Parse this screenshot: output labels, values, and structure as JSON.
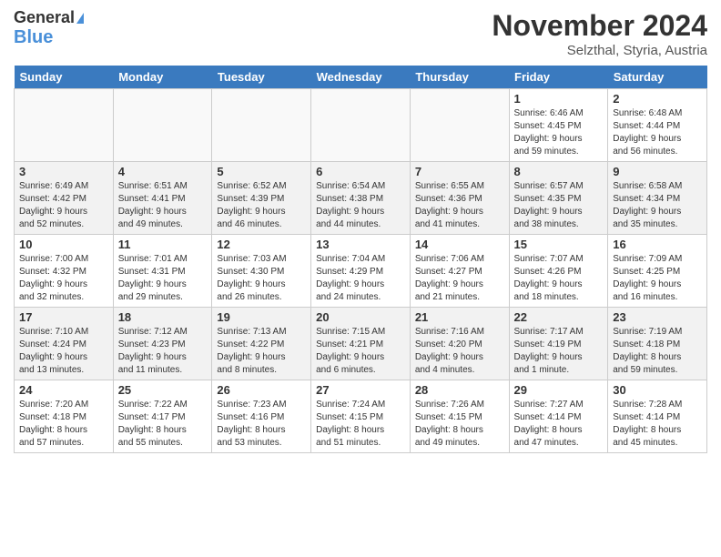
{
  "header": {
    "logo_line1": "General",
    "logo_line2": "Blue",
    "month_title": "November 2024",
    "location": "Selzthal, Styria, Austria"
  },
  "days_of_week": [
    "Sunday",
    "Monday",
    "Tuesday",
    "Wednesday",
    "Thursday",
    "Friday",
    "Saturday"
  ],
  "weeks": [
    [
      {
        "day": "",
        "info": ""
      },
      {
        "day": "",
        "info": ""
      },
      {
        "day": "",
        "info": ""
      },
      {
        "day": "",
        "info": ""
      },
      {
        "day": "",
        "info": ""
      },
      {
        "day": "1",
        "info": "Sunrise: 6:46 AM\nSunset: 4:45 PM\nDaylight: 9 hours\nand 59 minutes."
      },
      {
        "day": "2",
        "info": "Sunrise: 6:48 AM\nSunset: 4:44 PM\nDaylight: 9 hours\nand 56 minutes."
      }
    ],
    [
      {
        "day": "3",
        "info": "Sunrise: 6:49 AM\nSunset: 4:42 PM\nDaylight: 9 hours\nand 52 minutes."
      },
      {
        "day": "4",
        "info": "Sunrise: 6:51 AM\nSunset: 4:41 PM\nDaylight: 9 hours\nand 49 minutes."
      },
      {
        "day": "5",
        "info": "Sunrise: 6:52 AM\nSunset: 4:39 PM\nDaylight: 9 hours\nand 46 minutes."
      },
      {
        "day": "6",
        "info": "Sunrise: 6:54 AM\nSunset: 4:38 PM\nDaylight: 9 hours\nand 44 minutes."
      },
      {
        "day": "7",
        "info": "Sunrise: 6:55 AM\nSunset: 4:36 PM\nDaylight: 9 hours\nand 41 minutes."
      },
      {
        "day": "8",
        "info": "Sunrise: 6:57 AM\nSunset: 4:35 PM\nDaylight: 9 hours\nand 38 minutes."
      },
      {
        "day": "9",
        "info": "Sunrise: 6:58 AM\nSunset: 4:34 PM\nDaylight: 9 hours\nand 35 minutes."
      }
    ],
    [
      {
        "day": "10",
        "info": "Sunrise: 7:00 AM\nSunset: 4:32 PM\nDaylight: 9 hours\nand 32 minutes."
      },
      {
        "day": "11",
        "info": "Sunrise: 7:01 AM\nSunset: 4:31 PM\nDaylight: 9 hours\nand 29 minutes."
      },
      {
        "day": "12",
        "info": "Sunrise: 7:03 AM\nSunset: 4:30 PM\nDaylight: 9 hours\nand 26 minutes."
      },
      {
        "day": "13",
        "info": "Sunrise: 7:04 AM\nSunset: 4:29 PM\nDaylight: 9 hours\nand 24 minutes."
      },
      {
        "day": "14",
        "info": "Sunrise: 7:06 AM\nSunset: 4:27 PM\nDaylight: 9 hours\nand 21 minutes."
      },
      {
        "day": "15",
        "info": "Sunrise: 7:07 AM\nSunset: 4:26 PM\nDaylight: 9 hours\nand 18 minutes."
      },
      {
        "day": "16",
        "info": "Sunrise: 7:09 AM\nSunset: 4:25 PM\nDaylight: 9 hours\nand 16 minutes."
      }
    ],
    [
      {
        "day": "17",
        "info": "Sunrise: 7:10 AM\nSunset: 4:24 PM\nDaylight: 9 hours\nand 13 minutes."
      },
      {
        "day": "18",
        "info": "Sunrise: 7:12 AM\nSunset: 4:23 PM\nDaylight: 9 hours\nand 11 minutes."
      },
      {
        "day": "19",
        "info": "Sunrise: 7:13 AM\nSunset: 4:22 PM\nDaylight: 9 hours\nand 8 minutes."
      },
      {
        "day": "20",
        "info": "Sunrise: 7:15 AM\nSunset: 4:21 PM\nDaylight: 9 hours\nand 6 minutes."
      },
      {
        "day": "21",
        "info": "Sunrise: 7:16 AM\nSunset: 4:20 PM\nDaylight: 9 hours\nand 4 minutes."
      },
      {
        "day": "22",
        "info": "Sunrise: 7:17 AM\nSunset: 4:19 PM\nDaylight: 9 hours\nand 1 minute."
      },
      {
        "day": "23",
        "info": "Sunrise: 7:19 AM\nSunset: 4:18 PM\nDaylight: 8 hours\nand 59 minutes."
      }
    ],
    [
      {
        "day": "24",
        "info": "Sunrise: 7:20 AM\nSunset: 4:18 PM\nDaylight: 8 hours\nand 57 minutes."
      },
      {
        "day": "25",
        "info": "Sunrise: 7:22 AM\nSunset: 4:17 PM\nDaylight: 8 hours\nand 55 minutes."
      },
      {
        "day": "26",
        "info": "Sunrise: 7:23 AM\nSunset: 4:16 PM\nDaylight: 8 hours\nand 53 minutes."
      },
      {
        "day": "27",
        "info": "Sunrise: 7:24 AM\nSunset: 4:15 PM\nDaylight: 8 hours\nand 51 minutes."
      },
      {
        "day": "28",
        "info": "Sunrise: 7:26 AM\nSunset: 4:15 PM\nDaylight: 8 hours\nand 49 minutes."
      },
      {
        "day": "29",
        "info": "Sunrise: 7:27 AM\nSunset: 4:14 PM\nDaylight: 8 hours\nand 47 minutes."
      },
      {
        "day": "30",
        "info": "Sunrise: 7:28 AM\nSunset: 4:14 PM\nDaylight: 8 hours\nand 45 minutes."
      }
    ]
  ]
}
